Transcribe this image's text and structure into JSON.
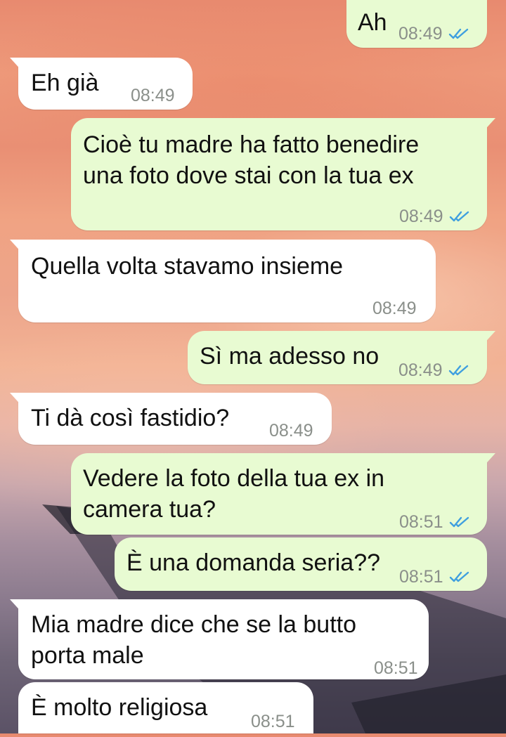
{
  "colors": {
    "outgoing_bubble": "#e8fbd2",
    "incoming_bubble": "#ffffff",
    "read_ticks": "#3f9fdf",
    "timestamp": "#8a8f8a"
  },
  "icons": {
    "read_receipt": "double-check-icon"
  },
  "messages": [
    {
      "direction": "outgoing",
      "text": "Ah",
      "time": "08:49",
      "read": true
    },
    {
      "direction": "incoming",
      "text": "Eh già",
      "time": "08:49"
    },
    {
      "direction": "outgoing",
      "text": "Cioè tu madre ha fatto benedire\nuna foto dove stai con la tua ex",
      "time": "08:49",
      "read": true
    },
    {
      "direction": "incoming",
      "text": "Quella volta stavamo insieme",
      "time": "08:49"
    },
    {
      "direction": "outgoing",
      "text": "Sì ma adesso no",
      "time": "08:49",
      "read": true
    },
    {
      "direction": "incoming",
      "text": "Ti dà così fastidio?",
      "time": "08:49"
    },
    {
      "direction": "outgoing",
      "text": "Vedere la foto della tua ex in\ncamera tua?",
      "time": "08:51",
      "read": true
    },
    {
      "direction": "outgoing",
      "text": "È una domanda seria??",
      "time": "08:51",
      "read": true
    },
    {
      "direction": "incoming",
      "text": "Mia madre dice che se la butto\nporta male",
      "time": "08:51"
    },
    {
      "direction": "incoming",
      "text": "È molto religiosa",
      "time": "08:51"
    }
  ]
}
